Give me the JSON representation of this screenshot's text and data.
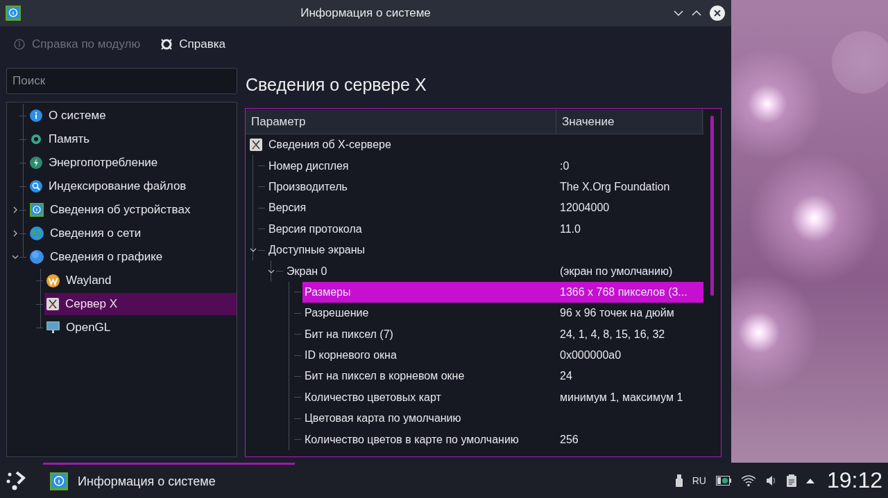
{
  "window": {
    "title": "Информация о системе"
  },
  "toolbar": [
    {
      "label": "Справка по модулю",
      "disabled": true
    },
    {
      "label": "Справка",
      "disabled": false
    }
  ],
  "search": {
    "placeholder": "Поиск"
  },
  "sidebar": {
    "items": [
      {
        "label": "О системе",
        "selected": false
      },
      {
        "label": "Память",
        "selected": false
      },
      {
        "label": "Энергопотребление",
        "selected": false
      },
      {
        "label": "Индексирование файлов",
        "selected": false
      },
      {
        "label": "Сведения об устройствах",
        "selected": false,
        "expanded": false
      },
      {
        "label": "Сведения о сети",
        "selected": false,
        "expanded": false
      },
      {
        "label": "Сведения о графике",
        "selected": false,
        "expanded": true,
        "children": [
          {
            "label": "Wayland",
            "selected": false
          },
          {
            "label": "Сервер X",
            "selected": true
          },
          {
            "label": "OpenGL",
            "selected": false
          }
        ]
      }
    ]
  },
  "content": {
    "heading": "Сведения о сервере X",
    "table": {
      "columns": [
        "Параметр",
        "Значение"
      ],
      "rows": [
        {
          "parameter": "Сведения об X-сервере",
          "selected": false,
          "children": [
            {
              "parameter": "Номер дисплея",
              "value": ":0",
              "selected": false
            },
            {
              "parameter": "Производитель",
              "value": "The X.Org Foundation",
              "selected": false
            },
            {
              "parameter": "Версия",
              "value": "12004000",
              "selected": false
            },
            {
              "parameter": "Версия протокола",
              "value": "11.0",
              "selected": false
            },
            {
              "parameter": "Доступные экраны",
              "selected": false,
              "expanded": true,
              "children": [
                {
                  "parameter": "Экран 0",
                  "value": "(экран по умолчанию)",
                  "selected": false,
                  "expanded": true,
                  "children": [
                    {
                      "parameter": "Размеры",
                      "value": "1366 x 768 пикселов (3...",
                      "selected": true
                    },
                    {
                      "parameter": "Разрешение",
                      "value": "96 x 96 точек на дюйм",
                      "selected": false
                    },
                    {
                      "parameter": "Бит на пиксел (7)",
                      "value": "24, 1, 4, 8, 15, 16, 32",
                      "selected": false
                    },
                    {
                      "parameter": "ID корневого окна",
                      "value": "0x000000a0",
                      "selected": false
                    },
                    {
                      "parameter": "Бит на пиксел в корневом окне",
                      "value": "24",
                      "selected": false
                    },
                    {
                      "parameter": "Количество цветовых карт",
                      "value": "минимум 1, максимум 1",
                      "selected": false
                    },
                    {
                      "parameter": "Цветовая карта по умолчанию",
                      "selected": false
                    },
                    {
                      "parameter": "Количество цветов в карте по умолчанию",
                      "value": "256",
                      "selected": false
                    }
                  ]
                }
              ]
            }
          ]
        }
      ]
    }
  },
  "taskbar": {
    "task": {
      "label": "Информация о системе",
      "selected": true
    },
    "tray": {
      "language": "RU"
    },
    "clock": "19:12"
  }
}
